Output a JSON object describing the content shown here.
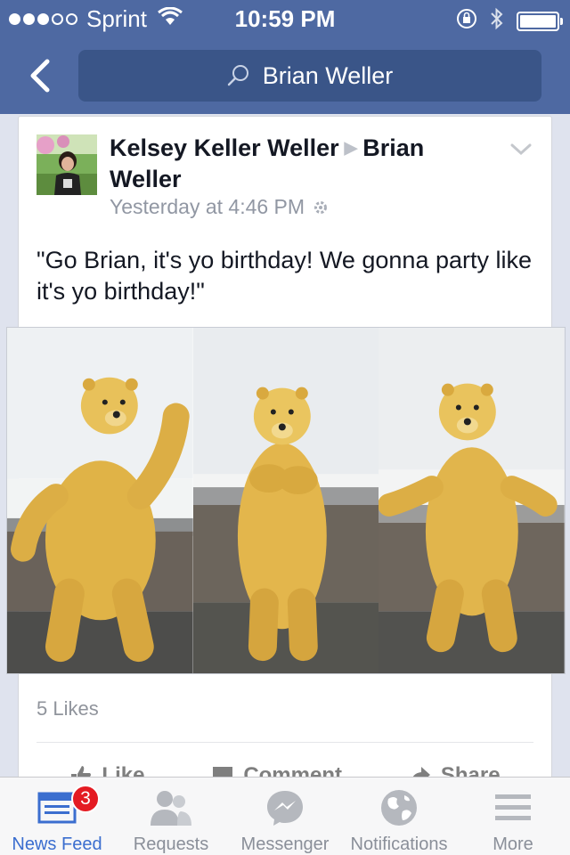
{
  "status_bar": {
    "carrier": "Sprint",
    "time": "10:59 PM",
    "signal_bars_full": 3,
    "signal_bars_total": 5
  },
  "nav": {
    "search_text": "Brian Weller",
    "back_icon": "chevron-left-icon",
    "search_icon": "search-icon"
  },
  "post": {
    "author": "Kelsey Keller Weller",
    "target": "Brian Weller",
    "timestamp": "Yesterday at 4:46 PM",
    "text": "\"Go Brian, it's yo birthday! We gonna party like it's yo birthday!\"",
    "likes": "5 Likes",
    "actions": {
      "like": "Like",
      "comment": "Comment",
      "share": "Share"
    }
  },
  "tab_bar": {
    "tabs": [
      {
        "label": "News Feed",
        "icon": "news-feed-icon",
        "active": true,
        "badge": "3"
      },
      {
        "label": "Requests",
        "icon": "friends-icon",
        "active": false
      },
      {
        "label": "Messenger",
        "icon": "messenger-icon",
        "active": false
      },
      {
        "label": "Notifications",
        "icon": "globe-icon",
        "active": false
      },
      {
        "label": "More",
        "icon": "menu-icon",
        "active": false
      }
    ]
  },
  "colors": {
    "brand": "#4e69a2",
    "search_bg": "#3a5588",
    "active_tab": "#3b6ecf",
    "badge": "#e41b23"
  }
}
